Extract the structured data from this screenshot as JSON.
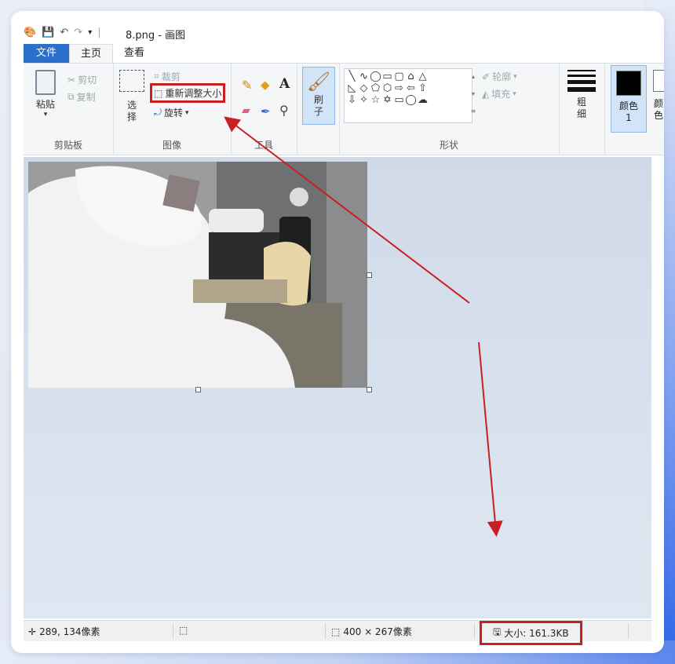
{
  "window": {
    "title": "8.png - 画图"
  },
  "tabs": [
    {
      "label": "文件"
    },
    {
      "label": "主页"
    },
    {
      "label": "查看"
    }
  ],
  "clipboard": {
    "paste": "粘贴",
    "cut": "剪切",
    "copy": "复制",
    "group": "剪贴板"
  },
  "image": {
    "select": "选择",
    "crop": "裁剪",
    "resize": "重新调整大小",
    "rotate": "旋转",
    "group": "图像"
  },
  "tools": {
    "group": "工具"
  },
  "brush": {
    "label": "刷子"
  },
  "shapes": {
    "outline": "轮廓",
    "fill": "填充",
    "group": "形状"
  },
  "size": {
    "label": "粗细"
  },
  "color1": {
    "label": "颜色 1",
    "value": "#000000"
  },
  "color2": {
    "label": "颜色"
  },
  "status": {
    "coords": "289, 134像素",
    "dimensions": "400 × 267像素",
    "filesize": "大小: 161.3KB"
  },
  "colors": {
    "accent": "#2a6fc9",
    "highlight": "#c82020"
  }
}
